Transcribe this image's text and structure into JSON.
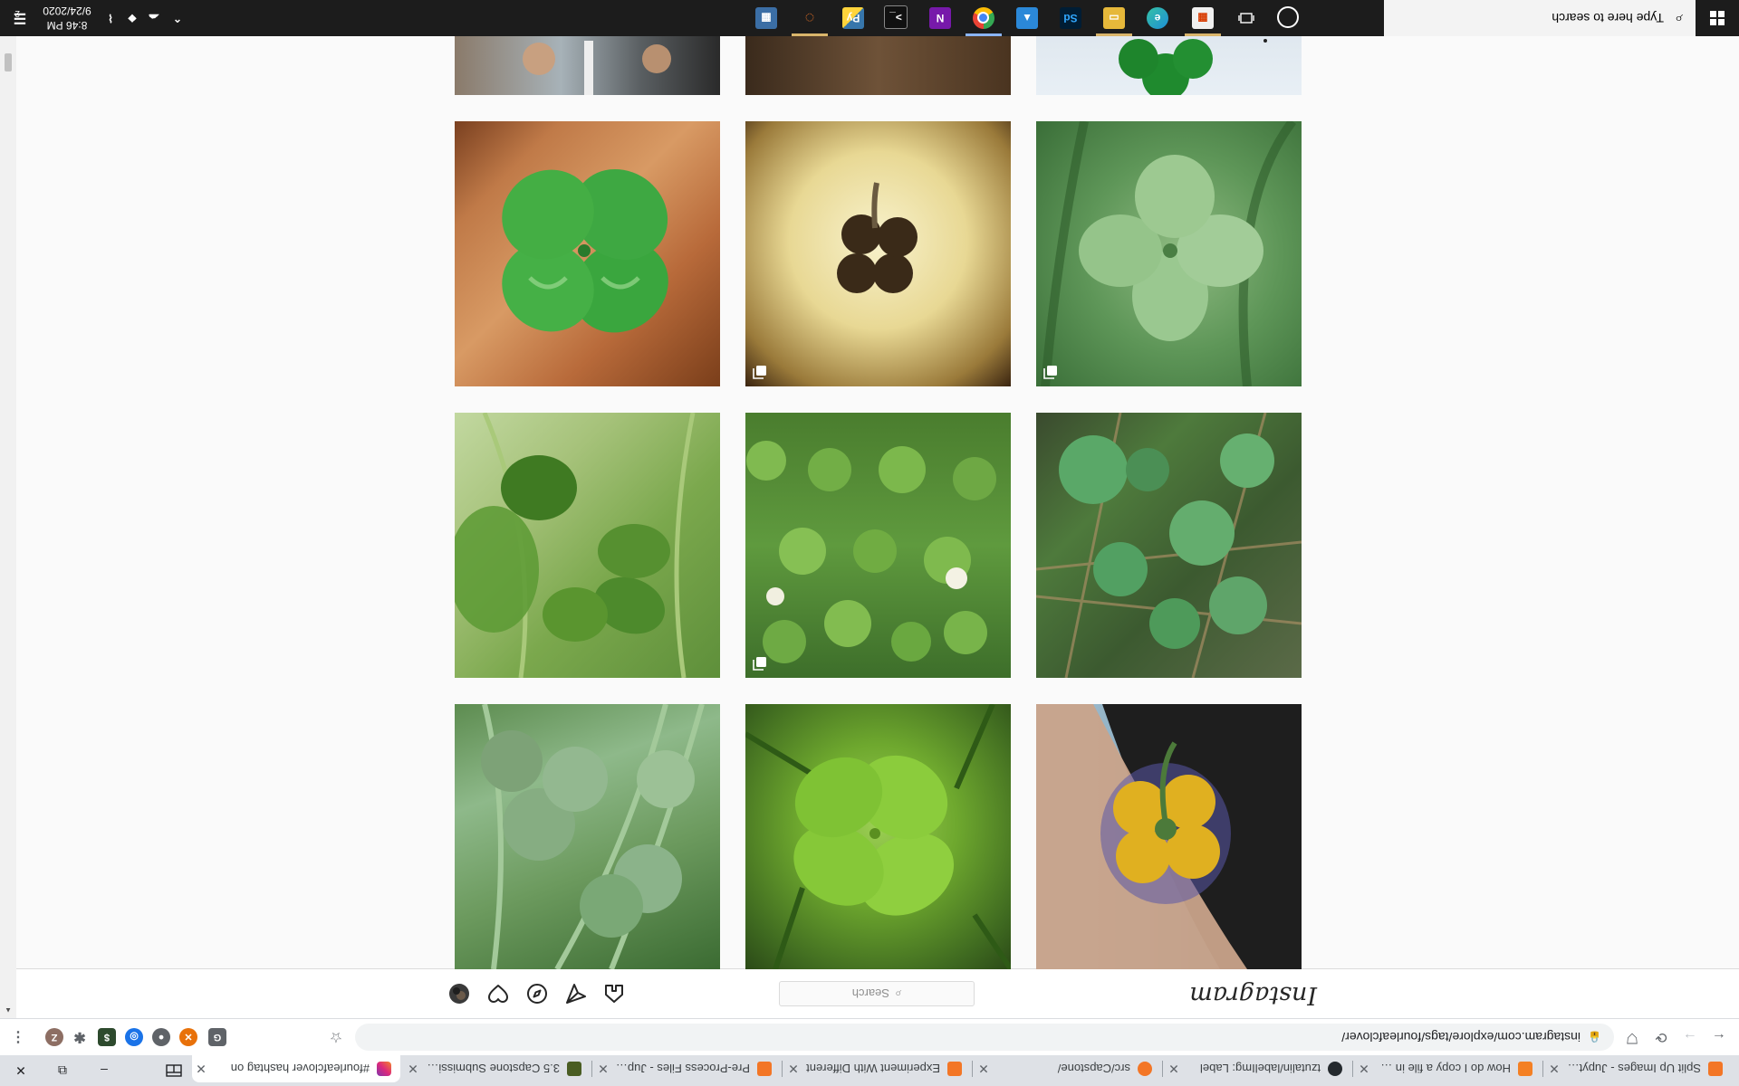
{
  "browser": {
    "tabs": [
      {
        "title": "Split Up Images - Jupyter N",
        "favicon_color": "#f37626",
        "active": false
      },
      {
        "title": "How do I copy a file in Pyth",
        "favicon_color": "#f48024",
        "active": false
      },
      {
        "title": "tzutalin/labelImg: Label",
        "favicon_color": "#24292e",
        "active": false
      },
      {
        "title": "src/Capstone/",
        "favicon_color": "#f37626",
        "active": false
      },
      {
        "title": "Experiment With Different",
        "favicon_color": "#f37626",
        "active": false
      },
      {
        "title": "Pre-Process Files - Jupyter",
        "favicon_color": "#f37626",
        "active": false
      },
      {
        "title": "3.5 Capstone Submission -",
        "favicon_color": "#4a5d23",
        "active": false
      },
      {
        "title": "#fourleafclover hashtag on",
        "favicon_color": "#e1306c",
        "active": true
      }
    ],
    "url": "instagram.com/explore/tags/fourleafclover/",
    "extensions": [
      {
        "name": "puzzle-piece-icon",
        "color": "#5f6368"
      },
      {
        "name": "ext-g",
        "color": "#5f6368"
      },
      {
        "name": "ext-orange",
        "color": "#e8710a"
      },
      {
        "name": "ext-circle",
        "color": "#5f6368"
      },
      {
        "name": "ext-blue",
        "color": "#1a73e8"
      },
      {
        "name": "ext-dark",
        "color": "#2d4a2d"
      },
      {
        "name": "extensions-icon",
        "color": "#5f6368"
      }
    ],
    "profile_initial": "Z"
  },
  "instagram": {
    "logo": "Instagram",
    "search_placeholder": "Search",
    "search_icon": "⌕"
  },
  "feed": {
    "tiles": [
      {
        "desc": "partial-photo-street",
        "multi": false
      },
      {
        "desc": "partial-photo-brown",
        "multi": false
      },
      {
        "desc": "partial-photo-clover-white",
        "multi": false
      },
      {
        "desc": "four-leaf-clover-on-leaves",
        "multi": false
      },
      {
        "desc": "clover-silhouette-sepia",
        "multi": true
      },
      {
        "desc": "clover-green-leaves",
        "multi": true
      },
      {
        "desc": "clover-among-grass",
        "multi": false
      },
      {
        "desc": "clover-patch-white-flowers",
        "multi": true
      },
      {
        "desc": "clover-on-dry-ground",
        "multi": false
      },
      {
        "desc": "clover-in-grass-close",
        "multi": false
      },
      {
        "desc": "bright-four-leaf-clover",
        "multi": false
      },
      {
        "desc": "clover-tattoo-on-wrist",
        "multi": false
      }
    ]
  },
  "taskbar": {
    "search_placeholder": "Type here to search",
    "time": "8:46 PM",
    "date": "9/24/2020",
    "notification_count": "2",
    "apps": [
      {
        "name": "file-explorer-icon",
        "color": "#f2c84b"
      },
      {
        "name": "edge-icon",
        "color": "#1e8fd6"
      },
      {
        "name": "file-folder-icon",
        "color": "#e6b83a"
      },
      {
        "name": "photoshop-icon",
        "color": "#001d34"
      },
      {
        "name": "photos-icon",
        "color": "#2b88d8"
      },
      {
        "name": "chrome-icon",
        "color": "#4285f4"
      },
      {
        "name": "onenote-icon",
        "color": "#7719aa"
      },
      {
        "name": "terminal-icon",
        "color": "#111111"
      },
      {
        "name": "python-icon",
        "color": "#3776ab"
      },
      {
        "name": "jupyter-icon",
        "color": "#f37626"
      },
      {
        "name": "office-icon",
        "color": "#3b6ea5"
      }
    ]
  }
}
